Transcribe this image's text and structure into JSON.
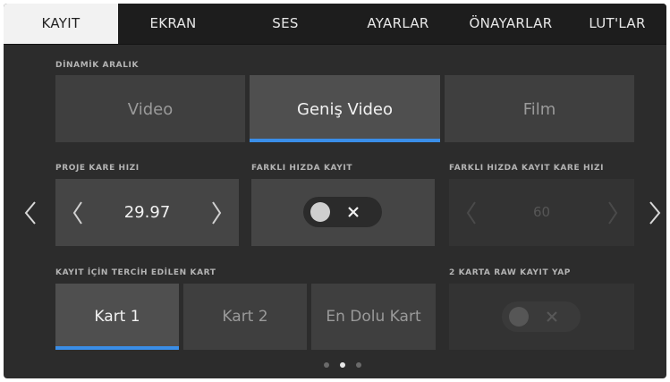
{
  "tabs": [
    {
      "label": "KAYIT",
      "active": true
    },
    {
      "label": "EKRAN",
      "active": false
    },
    {
      "label": "SES",
      "active": false
    },
    {
      "label": "AYARLAR",
      "active": false
    },
    {
      "label": "ÖNAYARLAR",
      "active": false
    },
    {
      "label": "LUT'LAR",
      "active": false
    }
  ],
  "dynamic_range": {
    "label": "DİNAMİK ARALIK",
    "options": [
      "Video",
      "Geniş Video",
      "Film"
    ],
    "selected": "Geniş Video"
  },
  "project_frame_rate": {
    "label": "PROJE KARE HIZI",
    "value": "29.97"
  },
  "off_speed_recording": {
    "label": "FARKLI HIZDA KAYIT",
    "enabled": false
  },
  "off_speed_frame_rate": {
    "label": "FARKLI HIZDA KAYIT KARE HIZI",
    "value": "60",
    "disabled": true
  },
  "preferred_card": {
    "label": "KAYIT İÇİN TERCİH EDİLEN KART",
    "options": [
      "Kart 1",
      "Kart 2",
      "En Dolu Kart"
    ],
    "selected": "Kart 1"
  },
  "raw_two_cards": {
    "label": "2 KARTA RAW KAYIT YAP",
    "enabled": false,
    "disabled": true
  },
  "pagination": {
    "pages": 3,
    "current": 2
  },
  "colors": {
    "accent": "#3a8ee8",
    "background": "#2c2c2c",
    "panel": "#3f3f3f",
    "panel_selected": "#4f4f4f"
  }
}
